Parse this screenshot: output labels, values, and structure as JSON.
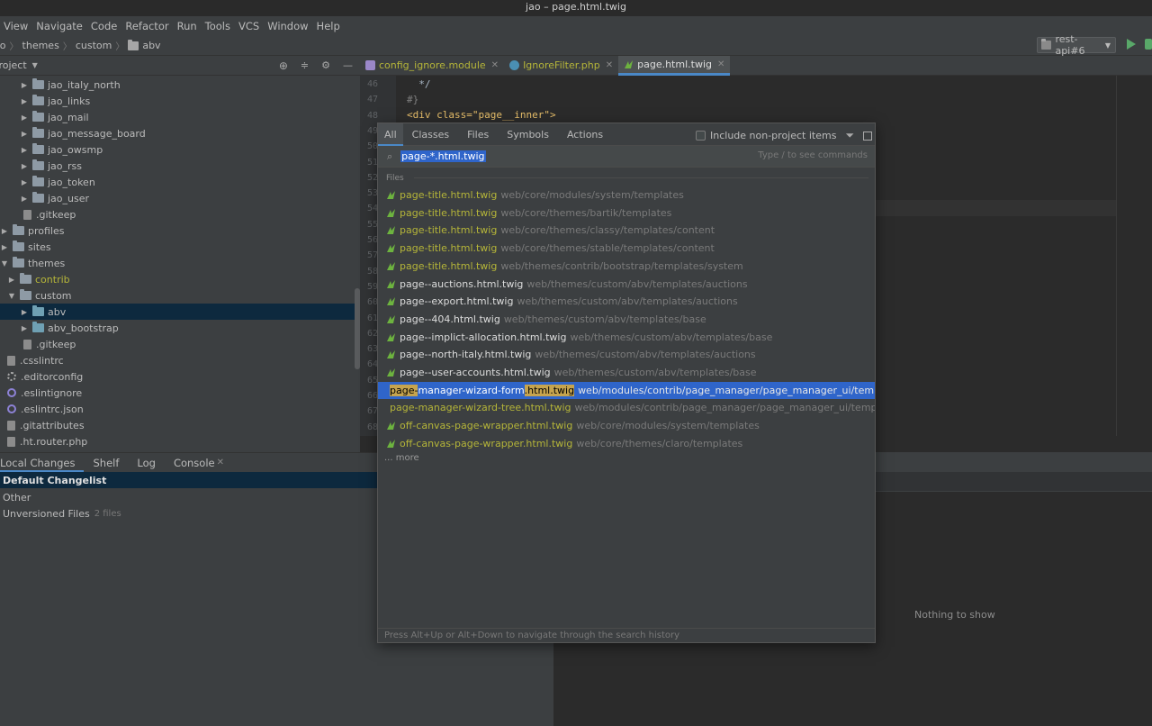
{
  "window": {
    "title": "jao – page.html.twig"
  },
  "menu": [
    "View",
    "Navigate",
    "Code",
    "Refactor",
    "Run",
    "Tools",
    "VCS",
    "Window",
    "Help"
  ],
  "breadcrumb": {
    "items": [
      "jao",
      "themes",
      "custom",
      "abv"
    ]
  },
  "run_config": {
    "label": "rest-api#6"
  },
  "project_panel": {
    "title": "Project",
    "tree": [
      {
        "label": "jao_italy_north",
        "type": "folder",
        "depth": 2
      },
      {
        "label": "jao_links",
        "type": "folder",
        "depth": 2
      },
      {
        "label": "jao_mail",
        "type": "folder",
        "depth": 2
      },
      {
        "label": "jao_message_board",
        "type": "folder",
        "depth": 2
      },
      {
        "label": "jao_owsmp",
        "type": "folder",
        "depth": 2
      },
      {
        "label": "jao_rss",
        "type": "folder",
        "depth": 2
      },
      {
        "label": "jao_token",
        "type": "folder",
        "depth": 2
      },
      {
        "label": "jao_user",
        "type": "folder",
        "depth": 2
      },
      {
        "label": ".gitkeep",
        "type": "file",
        "depth": 2
      },
      {
        "label": "profiles",
        "type": "folder",
        "depth": 0
      },
      {
        "label": "sites",
        "type": "folder",
        "depth": 0
      },
      {
        "label": "themes",
        "type": "folder-open",
        "depth": 0
      },
      {
        "label": "contrib",
        "type": "folder",
        "depth": 1
      },
      {
        "label": "custom",
        "type": "folder-open",
        "depth": 1
      },
      {
        "label": "abv",
        "type": "folder",
        "depth": 2
      },
      {
        "label": "abv_bootstrap",
        "type": "folder",
        "depth": 2
      },
      {
        "label": ".gitkeep",
        "type": "file",
        "depth": 2
      },
      {
        "label": ".csslintrc",
        "type": "file",
        "depth": 0
      },
      {
        "label": ".editorconfig",
        "type": "gear",
        "depth": 0
      },
      {
        "label": ".eslintignore",
        "type": "ring",
        "depth": 0
      },
      {
        "label": ".eslintrc.json",
        "type": "ring",
        "depth": 0
      },
      {
        "label": ".gitattributes",
        "type": "file",
        "depth": 0
      },
      {
        "label": ".ht.router.php",
        "type": "file",
        "depth": 0
      }
    ]
  },
  "vcs": {
    "tabs": [
      "Local Changes",
      "Shelf",
      "Log",
      "Console"
    ],
    "changelists": [
      {
        "label": "Default Changelist",
        "sub": ""
      },
      {
        "label": "Other",
        "sub": ""
      },
      {
        "label": "Unversioned Files",
        "sub": "2 files"
      }
    ],
    "empty_text": "Nothing to show"
  },
  "editor": {
    "tabs": [
      {
        "label": "config_ignore.module",
        "icon": "module-icon"
      },
      {
        "label": "IgnoreFilter.php",
        "icon": "php-icon"
      },
      {
        "label": "page.html.twig",
        "icon": "twig-icon"
      }
    ],
    "line_numbers": [
      "46",
      "47",
      "48",
      "49",
      "50",
      "51",
      "52",
      "53",
      "54",
      "55",
      "56",
      "57",
      "58",
      "59",
      "60",
      "61",
      "62",
      "63",
      "64",
      "65",
      "66",
      "67",
      "68"
    ],
    "code_lines": [
      "  */",
      "#}",
      "<div class=\"page__inner\">"
    ]
  },
  "search_popup": {
    "tabs": [
      "All",
      "Classes",
      "Files",
      "Symbols",
      "Actions"
    ],
    "include_label": "Include non-project items",
    "query": "page-*.html.twig",
    "hint": "Type / to see commands",
    "section_label": "Files",
    "results": [
      {
        "name": "page-title.html.twig",
        "path": "web/core/modules/system/templates",
        "color": "yellow"
      },
      {
        "name": "page-title.html.twig",
        "path": "web/core/themes/bartik/templates",
        "color": "yellow"
      },
      {
        "name": "page-title.html.twig",
        "path": "web/core/themes/classy/templates/content",
        "color": "yellow"
      },
      {
        "name": "page-title.html.twig",
        "path": "web/core/themes/stable/templates/content",
        "color": "yellow"
      },
      {
        "name": "page-title.html.twig",
        "path": "web/themes/contrib/bootstrap/templates/system",
        "color": "yellow"
      },
      {
        "name": "page--auctions.html.twig",
        "path": "web/themes/custom/abv/templates/auctions",
        "color": "white"
      },
      {
        "name": "page--export.html.twig",
        "path": "web/themes/custom/abv/templates/auctions",
        "color": "white"
      },
      {
        "name": "page--404.html.twig",
        "path": "web/themes/custom/abv/templates/base",
        "color": "white"
      },
      {
        "name": "page--implict-allocation.html.twig",
        "path": "web/themes/custom/abv/templates/base",
        "color": "white"
      },
      {
        "name": "page--north-italy.html.twig",
        "path": "web/themes/custom/abv/templates/auctions",
        "color": "white"
      },
      {
        "name": "page--user-accounts.html.twig",
        "path": "web/themes/custom/abv/templates/base",
        "color": "white"
      },
      {
        "name_parts": [
          "page-",
          "manager-wizard-form",
          ".html.twig"
        ],
        "path": "web/modules/contrib/page_manager/page_manager_ui/templates",
        "color": "selected"
      },
      {
        "name": "page-manager-wizard-tree.html.twig",
        "path": "web/modules/contrib/page_manager/page_manager_ui/templates",
        "color": "yellow"
      },
      {
        "name": "off-canvas-page-wrapper.html.twig",
        "path": "web/core/modules/system/templates",
        "color": "yellow"
      },
      {
        "name": "off-canvas-page-wrapper.html.twig",
        "path": "web/core/themes/claro/templates",
        "color": "yellow"
      }
    ],
    "more_label": "... more",
    "footer": "Press Alt+Up or Alt+Down to navigate through the search history"
  },
  "colors": {
    "selection": "#2f65ca",
    "accent": "#4a88c7",
    "twig_green": "#6db33f",
    "match_yellow": "#b5b539"
  }
}
